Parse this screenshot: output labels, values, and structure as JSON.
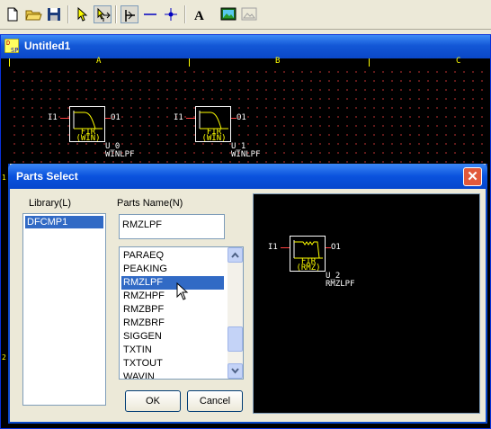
{
  "toolbar": {
    "buttons": [
      "new-file-icon",
      "open-folder-icon",
      "save-icon",
      "pointer-select-icon",
      "move-tool-icon",
      "wire-tool-icon",
      "horizontal-line-icon",
      "junction-dot-icon",
      "text-tool-icon",
      "image-tool-icon",
      "image-disabled-icon"
    ]
  },
  "document": {
    "title": "Untitled1",
    "columns": [
      "A",
      "B",
      "C"
    ],
    "rows": [
      "1",
      "2"
    ],
    "parts": [
      {
        "in": "I1",
        "out": "O1",
        "line1": "FIR",
        "line2": "(WIN)",
        "ref": "U_0",
        "name": "WINLPF"
      },
      {
        "in": "I1",
        "out": "O1",
        "line1": "FIR",
        "line2": "(WIN)",
        "ref": "U_1",
        "name": "WINLPF"
      }
    ]
  },
  "dialog": {
    "title": "Parts Select",
    "library_label": "Library(L)",
    "parts_name_label": "Parts Name(N)",
    "library_items": [
      "DFCMP1"
    ],
    "selected_library": "DFCMP1",
    "parts_name_value": "RMZLPF",
    "parts_list": [
      "PARAEQ",
      "PEAKING",
      "RMZLPF",
      "RMZHPF",
      "RMZBPF",
      "RMZBRF",
      "SIGGEN",
      "TXTIN",
      "TXTOUT",
      "WAVIN"
    ],
    "selected_part": "RMZLPF",
    "ok_label": "OK",
    "cancel_label": "Cancel",
    "preview": {
      "in": "I1",
      "out": "O1",
      "line1": "FIR",
      "line2": "(RMZ)",
      "ref": "U_2",
      "name": "RMZLPF"
    }
  },
  "colors": {
    "grid_dot": "#7a2020",
    "ruler": "#ffff00",
    "wire": "#ff4040",
    "selection": "#316ac5"
  }
}
